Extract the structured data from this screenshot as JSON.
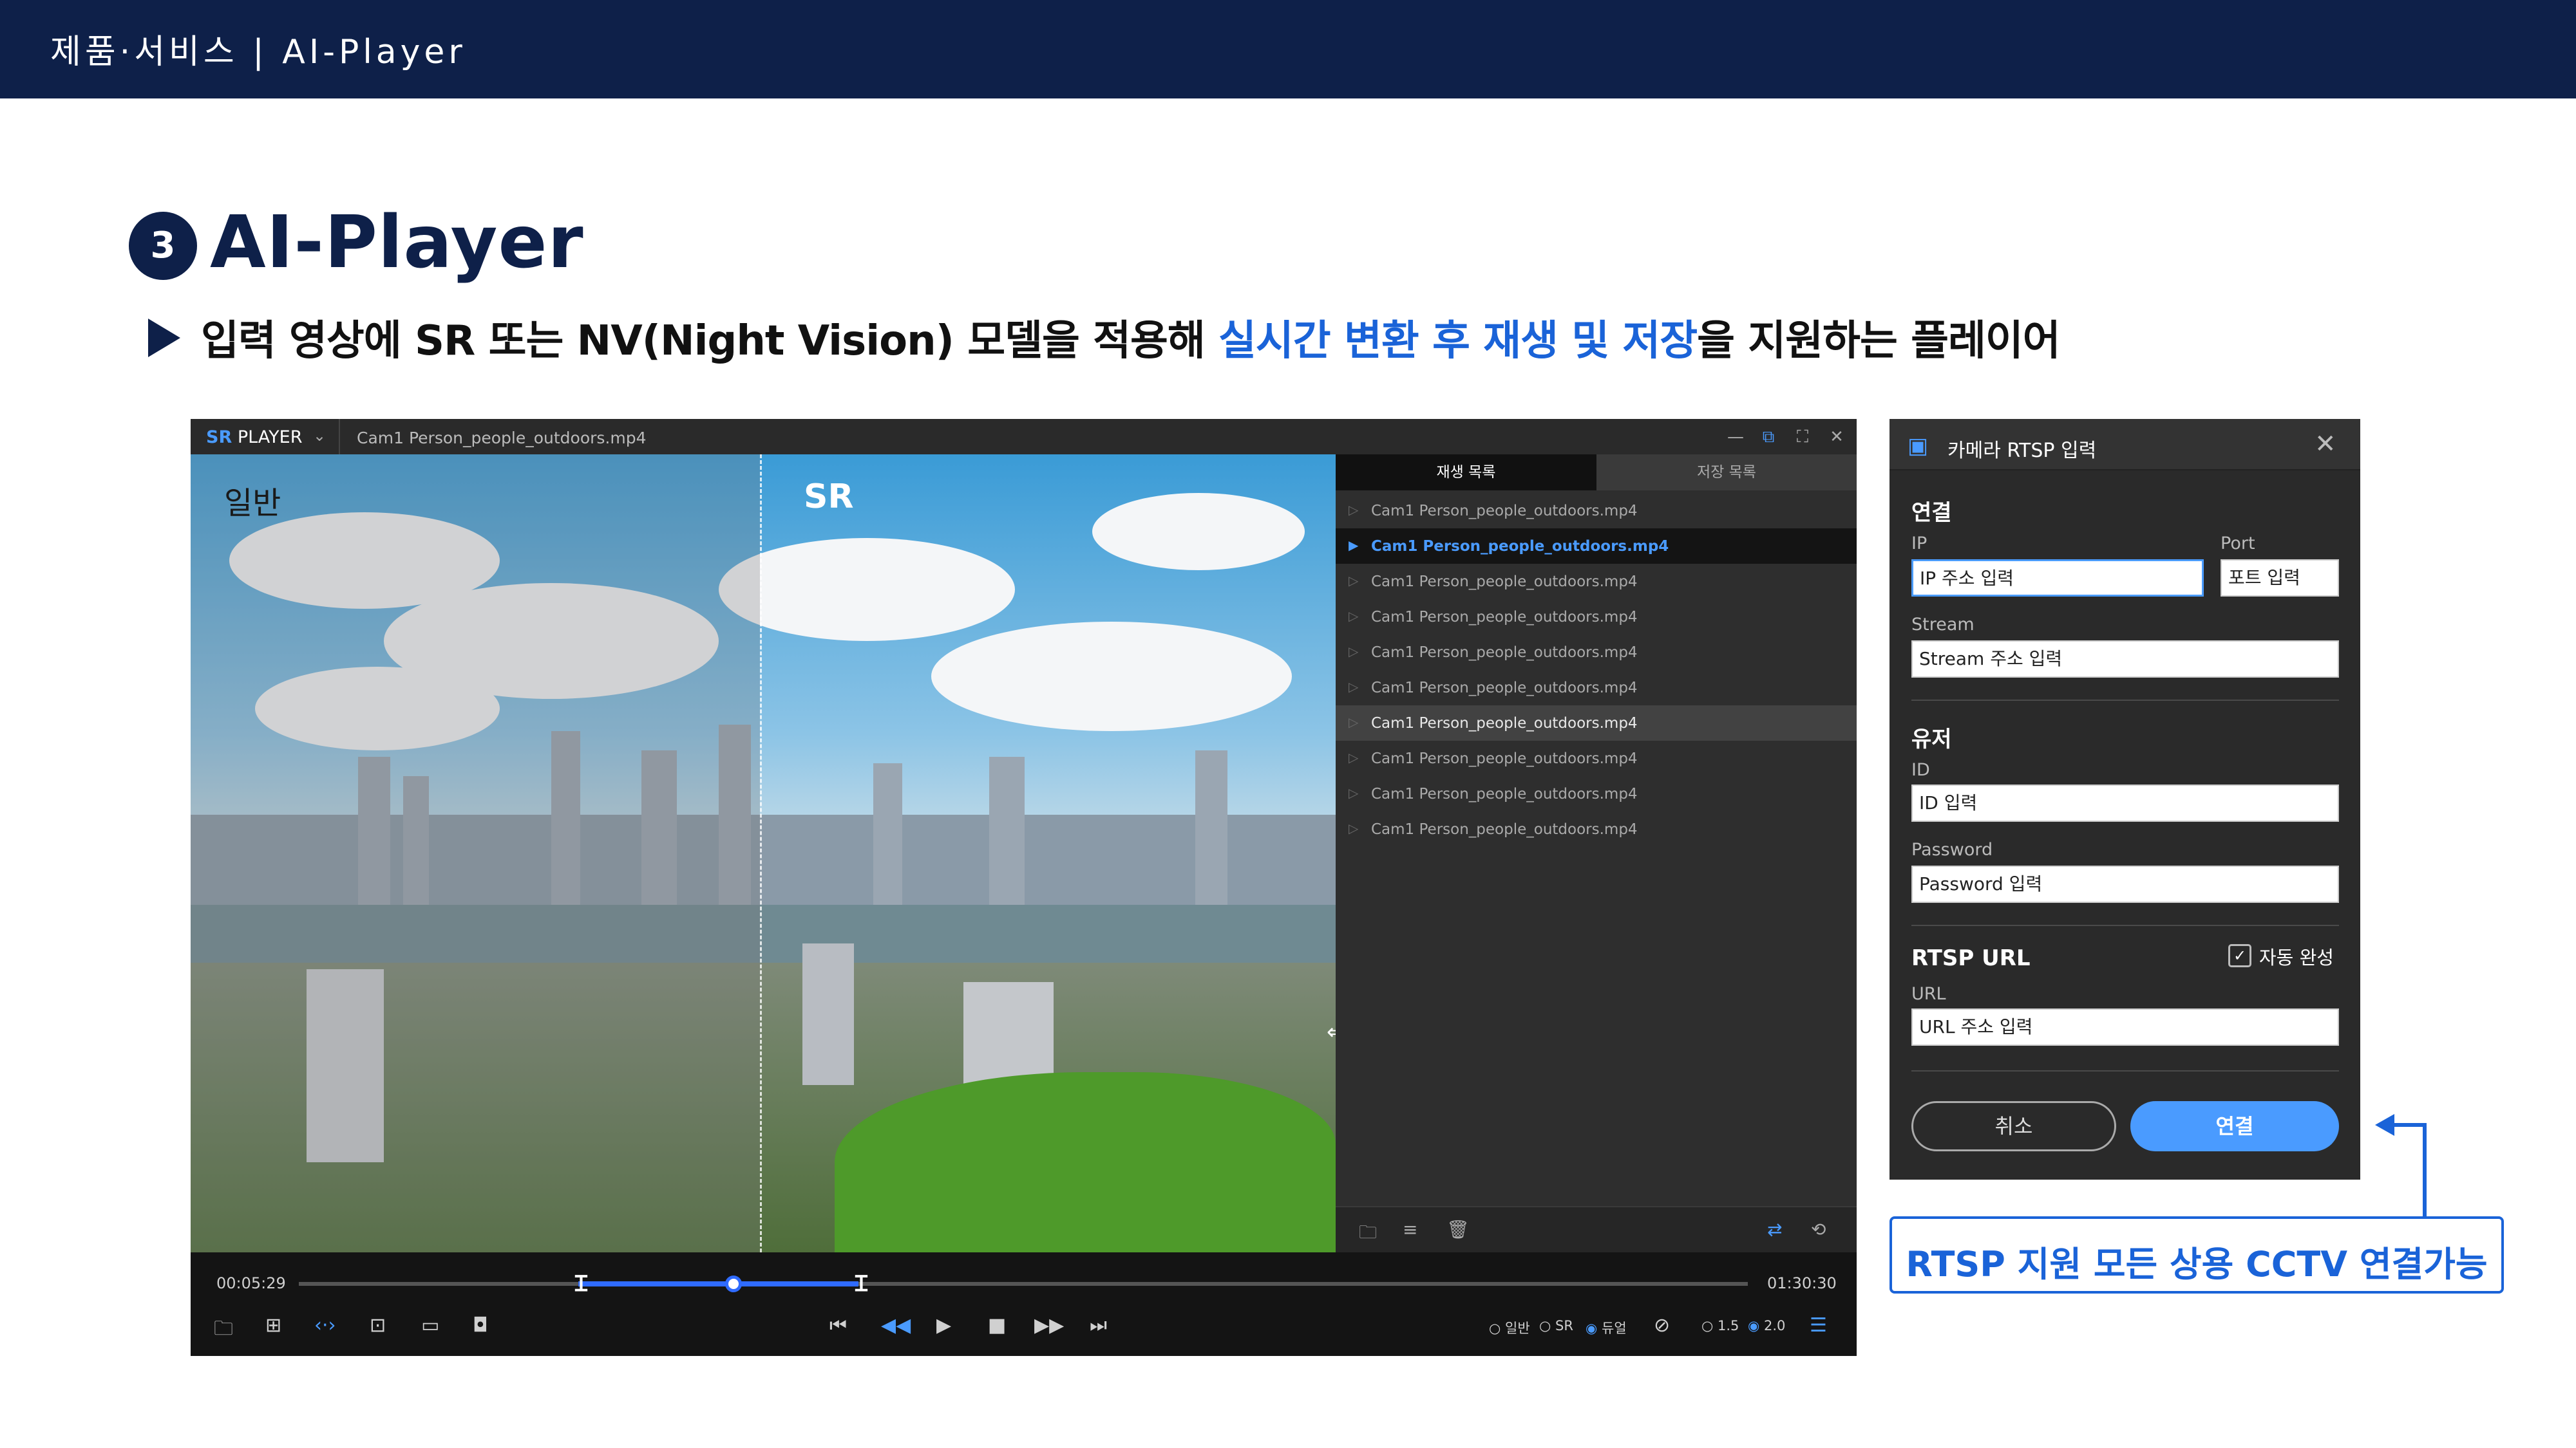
{
  "header": {
    "breadcrumb": "제품·서비스 |  AI-Player"
  },
  "section": {
    "number": "3",
    "title": "AI-Player",
    "subtitle_pre": "입력 영상에 SR 또는 NV(Night Vision) 모델을 적용해 ",
    "subtitle_highlight": "실시간 변환 후 재생 및 저장",
    "subtitle_post": "을 지원하는 플레이어"
  },
  "player": {
    "brand_sr": "SR",
    "brand_rest": " PLAYER",
    "filename": "Cam1 Person_people_outdoors.mp4",
    "video_label_normal": "일반",
    "video_label_sr": "SR",
    "tabs": [
      "재생 목록",
      "저장 목록"
    ],
    "playlist": [
      "Cam1 Person_people_outdoors.mp4",
      "Cam1 Person_people_outdoors.mp4",
      "Cam1 Person_people_outdoors.mp4",
      "Cam1 Person_people_outdoors.mp4",
      "Cam1 Person_people_outdoors.mp4",
      "Cam1 Person_people_outdoors.mp4",
      "Cam1 Person_people_outdoors.mp4",
      "Cam1 Person_people_outdoors.mp4",
      "Cam1 Person_people_outdoors.mp4",
      "Cam1 Person_people_outdoors.mp4"
    ],
    "active_index": 1,
    "hover_index": 6,
    "time_current": "00:05:29",
    "time_total": "01:30:30",
    "playhead_fraction": 0.3,
    "modes": {
      "normal": "일반",
      "sr": "SR",
      "dual": "듀얼",
      "selected": "듀얼"
    },
    "speeds": {
      "a": "1.5",
      "b": "2.0",
      "selected": "2.0"
    }
  },
  "dialog": {
    "title": "카메라 RTSP 입력",
    "connection_heading": "연결",
    "ip_label": "IP",
    "ip_placeholder": "IP 주소 입력",
    "port_label": "Port",
    "port_placeholder": "포트 입력",
    "stream_label": "Stream",
    "stream_placeholder": "Stream 주소 입력",
    "user_heading": "유저",
    "id_label": "ID",
    "id_placeholder": "ID 입력",
    "password_label": "Password",
    "password_placeholder": "Password 입력",
    "rtsp_heading": "RTSP URL",
    "auto_complete_label": "자동 완성",
    "auto_complete_checked": true,
    "url_label": "URL",
    "url_placeholder": "URL 주소 입력",
    "cancel_label": "취소",
    "connect_label": "연결"
  },
  "callout": {
    "text": "RTSP 지원 모든 상용 CCTV 연결가능"
  },
  "colors": {
    "navy": "#0e2049",
    "accent_blue": "#1a63d8",
    "player_blue": "#4a9bff"
  }
}
